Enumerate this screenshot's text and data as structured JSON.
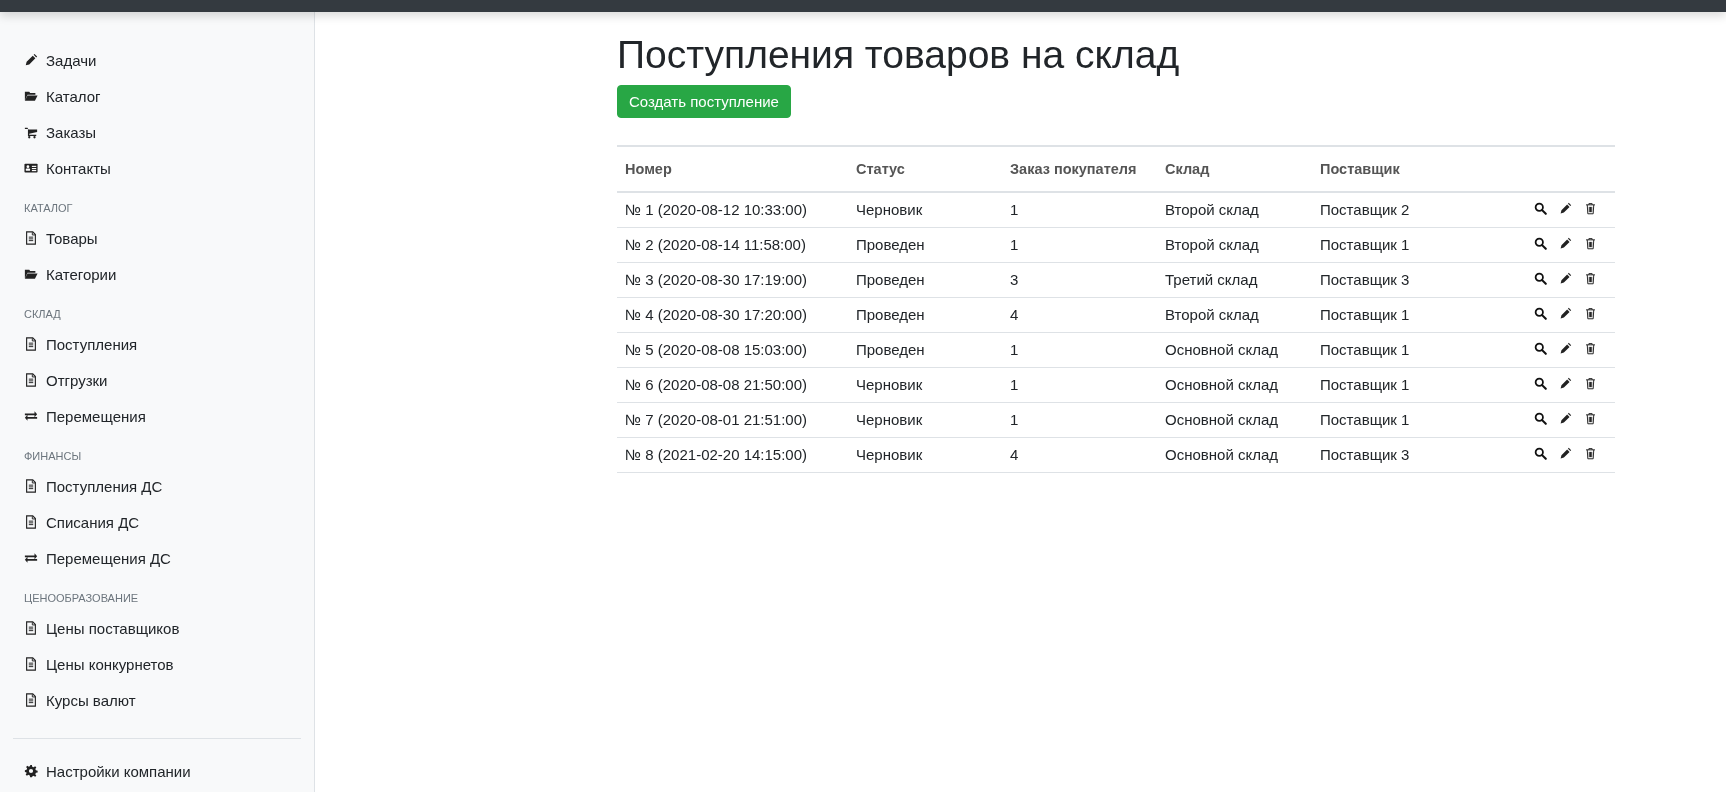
{
  "sidebar": {
    "sections": [
      {
        "items": [
          {
            "label": "Задачи"
          },
          {
            "label": "Каталог"
          },
          {
            "label": "Заказы"
          },
          {
            "label": "Контакты"
          }
        ]
      },
      {
        "heading": "КАТАЛОГ",
        "items": [
          {
            "label": "Товары"
          },
          {
            "label": "Категории"
          }
        ]
      },
      {
        "heading": "СКЛАД",
        "items": [
          {
            "label": "Поступления"
          },
          {
            "label": "Отгрузки"
          },
          {
            "label": "Перемещения"
          }
        ]
      },
      {
        "heading": "ФИНАНСЫ",
        "items": [
          {
            "label": "Поступления ДС"
          },
          {
            "label": "Списания ДС"
          },
          {
            "label": "Перемещения ДС"
          }
        ]
      },
      {
        "heading": "ЦЕНООБРАЗОВАНИЕ",
        "items": [
          {
            "label": "Цены поставщиков"
          },
          {
            "label": "Цены конкурнетов"
          },
          {
            "label": "Курсы валют"
          }
        ]
      },
      {
        "items": [
          {
            "label": "Настройки компании"
          }
        ]
      }
    ]
  },
  "page": {
    "title": "Поступления товаров на склад",
    "create_button": "Создать поступление"
  },
  "table": {
    "columns": [
      "Номер",
      "Статус",
      "Заказ покупателя",
      "Склад",
      "Поставщик"
    ],
    "rows": [
      [
        "№ 1 (2020-08-12 10:33:00)",
        "Черновик",
        "1",
        "Второй склад",
        "Поставщик 2"
      ],
      [
        "№ 2 (2020-08-14 11:58:00)",
        "Проведен",
        "1",
        "Второй склад",
        "Поставщик 1"
      ],
      [
        "№ 3 (2020-08-30 17:19:00)",
        "Проведен",
        "3",
        "Третий склад",
        "Поставщик 3"
      ],
      [
        "№ 4 (2020-08-30 17:20:00)",
        "Проведен",
        "4",
        "Второй склад",
        "Поставщик 1"
      ],
      [
        "№ 5 (2020-08-08 15:03:00)",
        "Проведен",
        "1",
        "Основной склад",
        "Поставщик 1"
      ],
      [
        "№ 6 (2020-08-08 21:50:00)",
        "Черновик",
        "1",
        "Основной склад",
        "Поставщик 1"
      ],
      [
        "№ 7 (2020-08-01 21:51:00)",
        "Черновик",
        "1",
        "Основной склад",
        "Поставщик 1"
      ],
      [
        "№ 8 (2021-02-20 14:15:00)",
        "Черновик",
        "4",
        "Основной склад",
        "Поставщик 3"
      ]
    ]
  }
}
